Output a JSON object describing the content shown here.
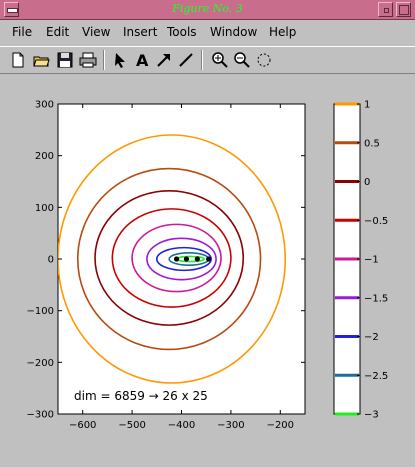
{
  "window": {
    "title": "Figure No. 3"
  },
  "menu": {
    "items": [
      "File",
      "Edit",
      "View",
      "Insert",
      "Tools",
      "Window",
      "Help"
    ]
  },
  "toolbar": {
    "icons": [
      "new-file-icon",
      "open-folder-icon",
      "save-icon",
      "print-icon",
      "select-arrow-icon",
      "insert-text-icon",
      "insert-arrow-icon",
      "insert-line-icon",
      "zoom-in-icon",
      "zoom-out-icon",
      "rotate-icon"
    ]
  },
  "chart_data": {
    "type": "contour",
    "xticks": [
      -600,
      -500,
      -400,
      -300,
      -200
    ],
    "yticks": [
      300,
      200,
      100,
      0,
      -100,
      -200,
      -300
    ],
    "xlim": [
      -650,
      -150
    ],
    "ylim": [
      -300,
      300
    ],
    "annotation": "dim = 6859 → 26 x 25",
    "colorbar": {
      "range": [
        -3,
        1
      ],
      "ticks": [
        "1",
        "0.5",
        "0",
        "−0.5",
        "−1",
        "−1.5",
        "−2",
        "−2.5",
        "−3"
      ],
      "levels": [
        1,
        0.5,
        0,
        -0.5,
        -1,
        -1.5,
        -2,
        -2.5,
        -3
      ],
      "colors": [
        "#ff9900",
        "#b84a10",
        "#8b0000",
        "#cc0000",
        "#cc1a99",
        "#9b1adb",
        "#2222dd",
        "#1a6e99",
        "#22ee22"
      ]
    },
    "contours": [
      {
        "level": 1,
        "color": "#ff9900",
        "cx": -420,
        "cy": 0,
        "rx": 230,
        "ry": 240
      },
      {
        "level": 0.5,
        "color": "#b84a10",
        "cx": -425,
        "cy": 0,
        "rx": 185,
        "ry": 175
      },
      {
        "level": 0,
        "color": "#8b0000",
        "cx": -425,
        "cy": 2,
        "rx": 150,
        "ry": 130
      },
      {
        "level": -0.5,
        "color": "#cc0000",
        "cx": -420,
        "cy": 2,
        "rx": 120,
        "ry": 95
      },
      {
        "level": -1,
        "color": "#cc1a99",
        "cx": -410,
        "cy": 2,
        "rx": 90,
        "ry": 65
      },
      {
        "level": -1.5,
        "color": "#9b1adb",
        "cx": -400,
        "cy": 0,
        "rx": 70,
        "ry": 40
      },
      {
        "level": -2,
        "color": "#2222dd",
        "cx": -395,
        "cy": 0,
        "rx": 55,
        "ry": 22
      },
      {
        "level": -2.5,
        "color": "#1a6e99",
        "cx": -385,
        "cy": 0,
        "rx": 40,
        "ry": 12
      },
      {
        "level": -3,
        "color": "#22ee22",
        "cx": -382,
        "cy": 0,
        "rx": 28,
        "ry": 5
      }
    ],
    "points": [
      {
        "x": -410,
        "y": 0
      },
      {
        "x": -390,
        "y": 0
      },
      {
        "x": -368,
        "y": 0
      },
      {
        "x": -345,
        "y": 0
      }
    ]
  }
}
